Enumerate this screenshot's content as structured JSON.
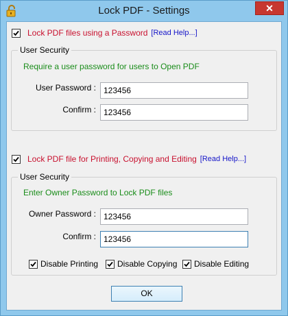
{
  "window": {
    "title": "Lock PDF - Settings",
    "close_label": "✕"
  },
  "user_section": {
    "checkbox_checked": true,
    "label": "Lock PDF files using a Password",
    "help": "[Read Help...]",
    "group_title": "User Security",
    "hint": "Require a user password for users to Open PDF",
    "password_label": "User Password :",
    "password_value": "123456",
    "confirm_label": "Confirm :",
    "confirm_value": "123456"
  },
  "owner_section": {
    "checkbox_checked": true,
    "label": "Lock PDF file for Printing, Copying and Editing",
    "help": "[Read Help...]",
    "group_title": "User Security",
    "hint": "Enter Owner Password to Lock PDF files",
    "password_label": "Owner Password :",
    "password_value": "123456",
    "confirm_label": "Confirm :",
    "confirm_value": "123456",
    "options": [
      {
        "label": "Disable Printing",
        "checked": true
      },
      {
        "label": "Disable Copying",
        "checked": true
      },
      {
        "label": "Disable Editing",
        "checked": true
      }
    ]
  },
  "buttons": {
    "ok": "OK"
  },
  "colors": {
    "title_bg": "#8fc8ec",
    "close_bg": "#c7372f",
    "red_label": "#c8102e",
    "link": "#1515c8",
    "hint_green": "#198c19"
  }
}
